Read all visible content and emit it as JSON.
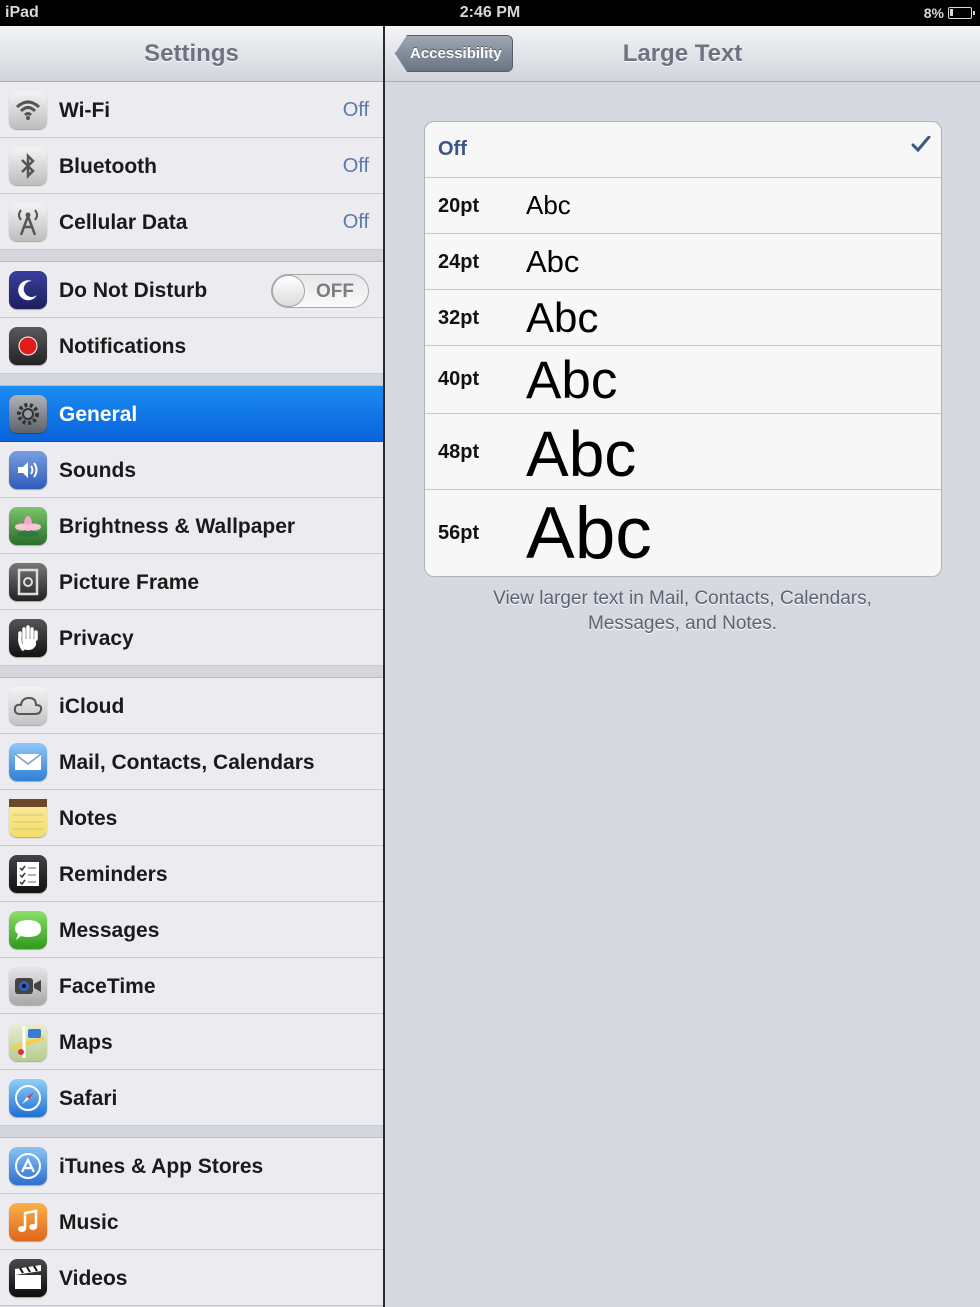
{
  "status_bar": {
    "carrier": "iPad",
    "time": "2:46 PM",
    "battery": "8%"
  },
  "master": {
    "title": "Settings",
    "groups": [
      [
        {
          "label": "Wi-Fi",
          "value": "Off",
          "icon": "wifi-icon"
        },
        {
          "label": "Bluetooth",
          "value": "Off",
          "icon": "bluetooth-icon"
        },
        {
          "label": "Cellular Data",
          "value": "Off",
          "icon": "cellular-icon"
        }
      ],
      [
        {
          "label": "Do Not Disturb",
          "toggle": "OFF",
          "icon": "moon-icon"
        },
        {
          "label": "Notifications",
          "icon": "notifications-icon"
        }
      ],
      [
        {
          "label": "General",
          "icon": "gear-icon",
          "selected": true
        },
        {
          "label": "Sounds",
          "icon": "speaker-icon"
        },
        {
          "label": "Brightness & Wallpaper",
          "icon": "flower-icon"
        },
        {
          "label": "Picture Frame",
          "icon": "picture-frame-icon"
        },
        {
          "label": "Privacy",
          "icon": "hand-icon"
        }
      ],
      [
        {
          "label": "iCloud",
          "icon": "cloud-icon"
        },
        {
          "label": "Mail, Contacts, Calendars",
          "icon": "mail-icon"
        },
        {
          "label": "Notes",
          "icon": "notes-icon"
        },
        {
          "label": "Reminders",
          "icon": "reminders-icon"
        },
        {
          "label": "Messages",
          "icon": "messages-icon"
        },
        {
          "label": "FaceTime",
          "icon": "facetime-icon"
        },
        {
          "label": "Maps",
          "icon": "maps-icon"
        },
        {
          "label": "Safari",
          "icon": "safari-icon"
        }
      ],
      [
        {
          "label": "iTunes & App Stores",
          "icon": "app-store-icon"
        },
        {
          "label": "Music",
          "icon": "music-icon"
        },
        {
          "label": "Videos",
          "icon": "videos-icon"
        }
      ]
    ]
  },
  "detail": {
    "back_label": "Accessibility",
    "title": "Large Text",
    "off_label": "Off",
    "sample": "Abc",
    "sizes": [
      "20pt",
      "24pt",
      "32pt",
      "40pt",
      "48pt",
      "56pt"
    ],
    "caption_line1": "View larger text in Mail, Contacts, Calendars,",
    "caption_line2": "Messages, and Notes."
  },
  "colors": {
    "selection": "#0a63dd",
    "accent_text": "#3b5584"
  }
}
